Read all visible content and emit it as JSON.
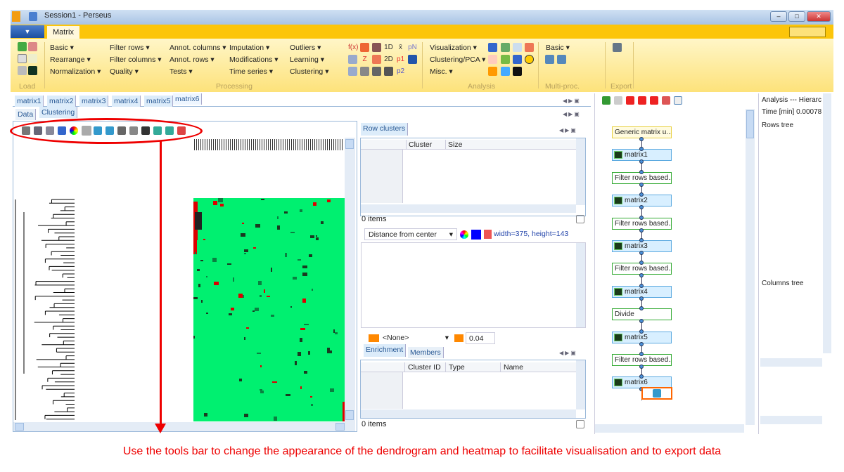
{
  "window": {
    "title": "Session1  -  Perseus"
  },
  "ribbon": {
    "tab": "Matrix",
    "groups": {
      "load": "Load",
      "processing": "Processing",
      "analysis": "Analysis",
      "multiproc": "Multi-proc.",
      "export": "Export"
    },
    "processing_cols": [
      [
        "Basic ▾",
        "Rearrange ▾",
        "Normalization ▾"
      ],
      [
        "Filter rows ▾",
        "Filter columns ▾",
        "Quality ▾"
      ],
      [
        "Annot. columns ▾",
        "Annot. rows ▾",
        "Tests ▾"
      ],
      [
        "Imputation ▾",
        "Modifications ▾",
        "Time series ▾"
      ],
      [
        "Outliers ▾",
        "Learning ▾",
        "Clustering ▾"
      ]
    ],
    "icon_text": [
      "f(x)",
      "1D",
      "x̄",
      "pN",
      "Z",
      "2D",
      "p1",
      "p2"
    ],
    "analysis": [
      "Visualization ▾",
      "Clustering/PCA ▾",
      "Misc. ▾"
    ],
    "multiproc": [
      "Basic ▾"
    ]
  },
  "matrix_tabs": [
    "matrix1",
    "matrix2",
    "matrix3",
    "matrix4",
    "matrix5",
    "matrix6"
  ],
  "sub_tabs": [
    "Data",
    "Clustering"
  ],
  "row_clusters": {
    "tab": "Row clusters",
    "columns": [
      "Cluster",
      "Size"
    ],
    "count": "0 items",
    "distance": "Distance from center",
    "size_text": "width=375, height=143"
  },
  "enrichment": {
    "select": "<None>",
    "value": "0.04",
    "tabs": [
      "Enrichment",
      "Members"
    ],
    "columns": [
      "Cluster ID",
      "Type",
      "Name"
    ],
    "count": "0 items"
  },
  "workflow": [
    "Generic matrix u...",
    "matrix1",
    "Filter rows based...",
    "matrix2",
    "Filter rows based...",
    "matrix3",
    "Filter rows based...",
    "matrix4",
    "Divide",
    "matrix5",
    "Filter rows based...",
    "matrix6"
  ],
  "analysis_panel": {
    "title": "Analysis --- Hierarc",
    "time": "Time [min] 0.00078",
    "rows": "Rows tree",
    "columns": "Columns tree"
  },
  "caption": "Use the tools bar to change the appearance of the dendrogram and heatmap to facilitate visualisation and to export data",
  "colors": {
    "heatmap": "#00f070",
    "annotation": "#e00000",
    "ribbon": "#fcc50a"
  }
}
